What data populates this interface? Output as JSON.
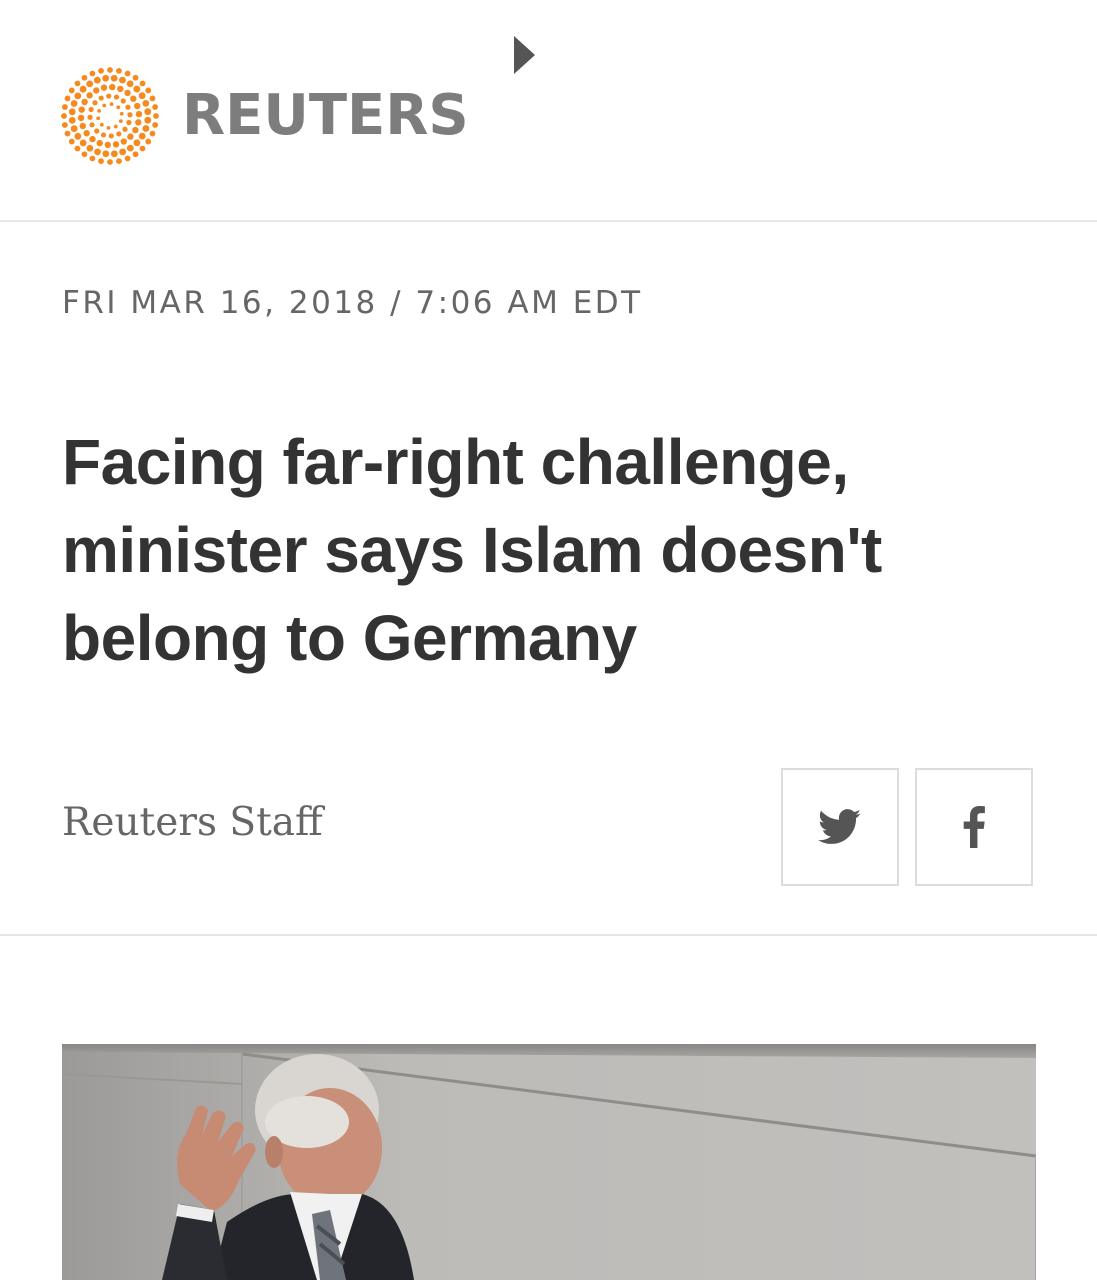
{
  "header": {
    "brand_name": "REUTERS",
    "logo_icon": "reuters-dot-sphere-logo",
    "media_icon": "play-arrow-icon",
    "brand_color": "#f68a1f"
  },
  "article": {
    "dateline": "FRI MAR 16, 2018 / 7:06 AM EDT",
    "headline": "Facing far-right challenge, minister says Islam doesn't belong to Germany",
    "byline": "Reuters Staff",
    "share": {
      "twitter_icon": "twitter-bird-icon",
      "facebook_icon": "facebook-f-icon"
    },
    "photo": {
      "subject": "lead-photo"
    }
  },
  "colors": {
    "headline": "#333333",
    "meta_text": "#666666",
    "logo_text": "#7d7d7d",
    "divider": "#e8e8e8"
  }
}
